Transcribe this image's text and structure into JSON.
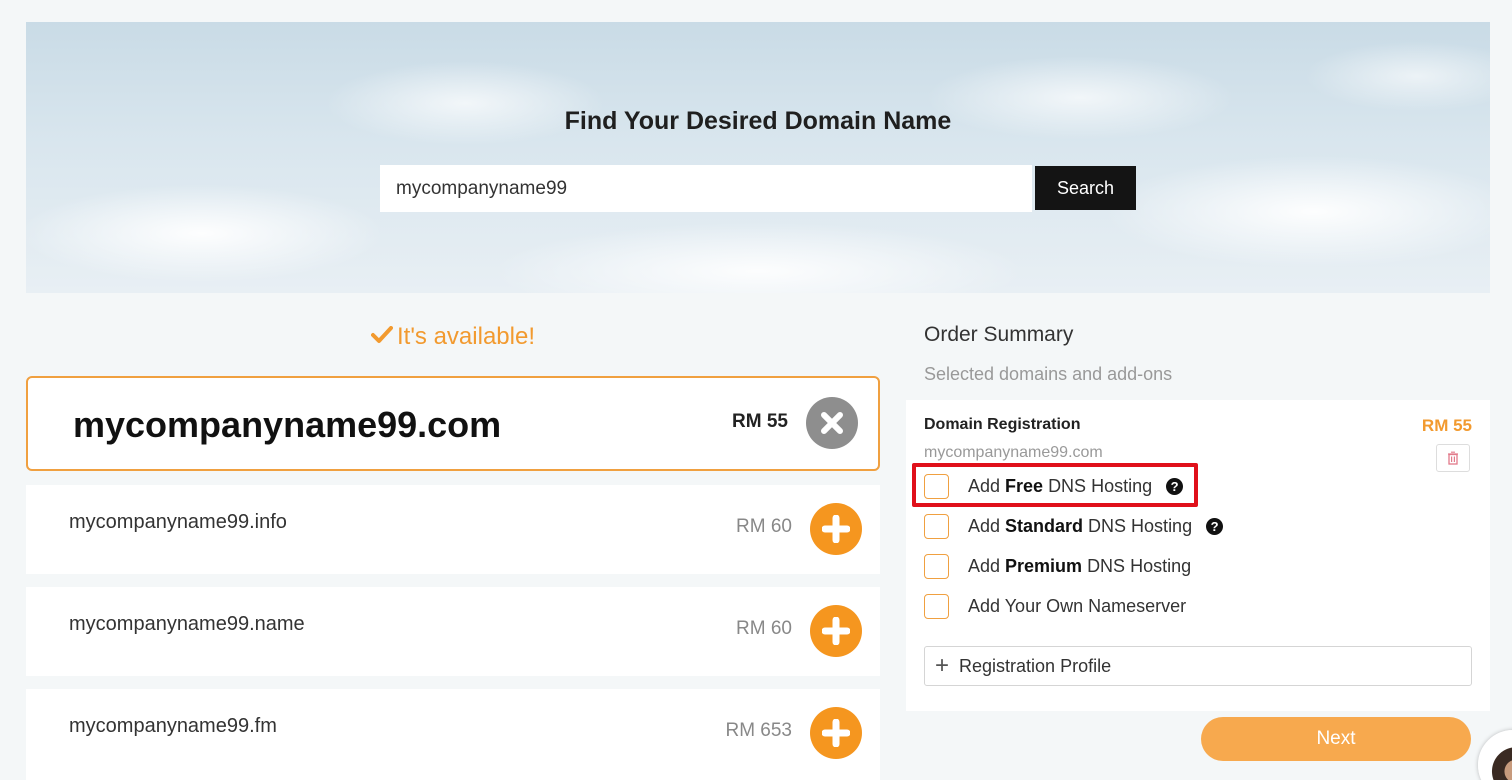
{
  "hero": {
    "title": "Find Your Desired Domain Name",
    "search_value": "mycompanyname99",
    "search_button": "Search"
  },
  "availability": {
    "message": "It's available!"
  },
  "domains": [
    {
      "name": "mycompanyname99.com",
      "price": "RM 55",
      "selected": true
    },
    {
      "name": "mycompanyname99.info",
      "price": "RM 60",
      "selected": false
    },
    {
      "name": "mycompanyname99.name",
      "price": "RM 60",
      "selected": false
    },
    {
      "name": "mycompanyname99.fm",
      "price": "RM 653",
      "selected": false
    }
  ],
  "summary": {
    "title": "Order Summary",
    "subtitle": "Selected domains and add-ons",
    "registration_label": "Domain Registration",
    "registration_price": "RM 55",
    "registration_domain": "mycompanyname99.com",
    "options": [
      {
        "pre": "Add",
        "bold": "Free",
        "post": "DNS Hosting",
        "help": true
      },
      {
        "pre": "Add",
        "bold": "Standard",
        "post": "DNS Hosting",
        "help": true
      },
      {
        "pre": "Add",
        "bold": "Premium",
        "post": "DNS Hosting",
        "help": false
      },
      {
        "pre": "Add Your Own Nameserver",
        "bold": "",
        "post": "",
        "help": false
      }
    ],
    "profile_label": "Registration Profile"
  },
  "next_button": "Next",
  "colors": {
    "accent": "#f5961f",
    "highlight": "#e0101a"
  }
}
